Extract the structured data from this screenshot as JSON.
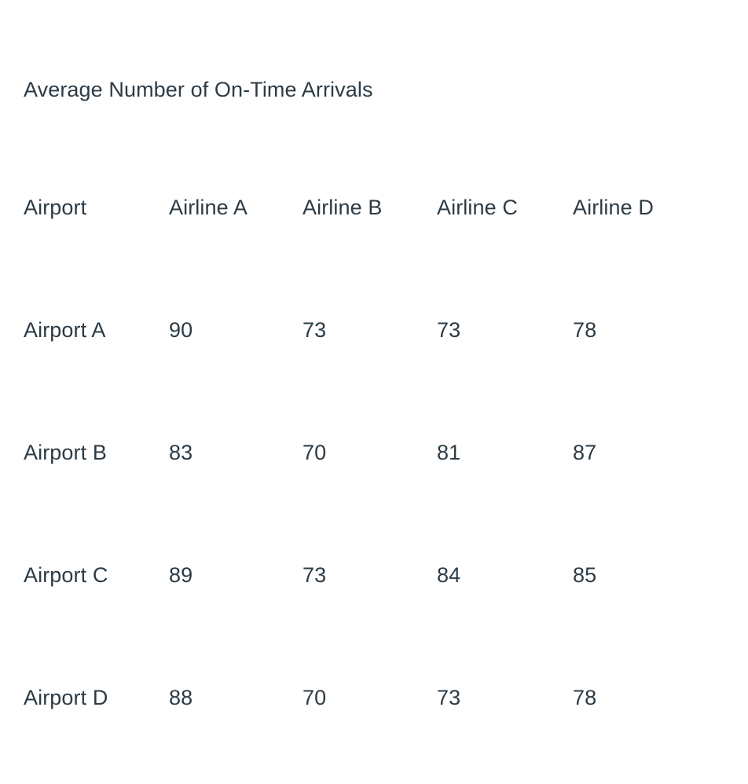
{
  "document": {
    "title": "Average Number of On-Time Arrivals",
    "background_color": "#ffffff",
    "text_color": "#2d3b45"
  },
  "table": {
    "caption": "Average Number of On-Time Arrivals",
    "columns": [
      "Airport",
      "Airline A",
      "Airline B",
      "Airline C",
      "Airline D"
    ],
    "rows": [
      {
        "airport": "Airport A",
        "airline_a": "90",
        "airline_b": "73",
        "airline_c": "73",
        "airline_d": "78"
      },
      {
        "airport": "Airport B",
        "airline_a": "83",
        "airline_b": "70",
        "airline_c": "81",
        "airline_d": "87"
      },
      {
        "airport": "Airport C",
        "airline_a": "89",
        "airline_b": "73",
        "airline_c": "84",
        "airline_d": "85"
      },
      {
        "airport": "Airport D",
        "airline_a": "88",
        "airline_b": "70",
        "airline_c": "73",
        "airline_d": "78"
      }
    ]
  },
  "chart_data": {
    "type": "table",
    "title": "Average Number of On-Time Arrivals",
    "xlabel": "",
    "ylabel": "",
    "categories": [
      "Airport A",
      "Airport B",
      "Airport C",
      "Airport D"
    ],
    "series": [
      {
        "name": "Airline A",
        "values": [
          90,
          83,
          89,
          88
        ]
      },
      {
        "name": "Airline B",
        "values": [
          73,
          70,
          73,
          70
        ]
      },
      {
        "name": "Airline C",
        "values": [
          73,
          81,
          84,
          73
        ]
      },
      {
        "name": "Airline D",
        "values": [
          78,
          87,
          85,
          78
        ]
      }
    ],
    "row_header_label": "Airport",
    "grid": false,
    "legend": "none"
  }
}
